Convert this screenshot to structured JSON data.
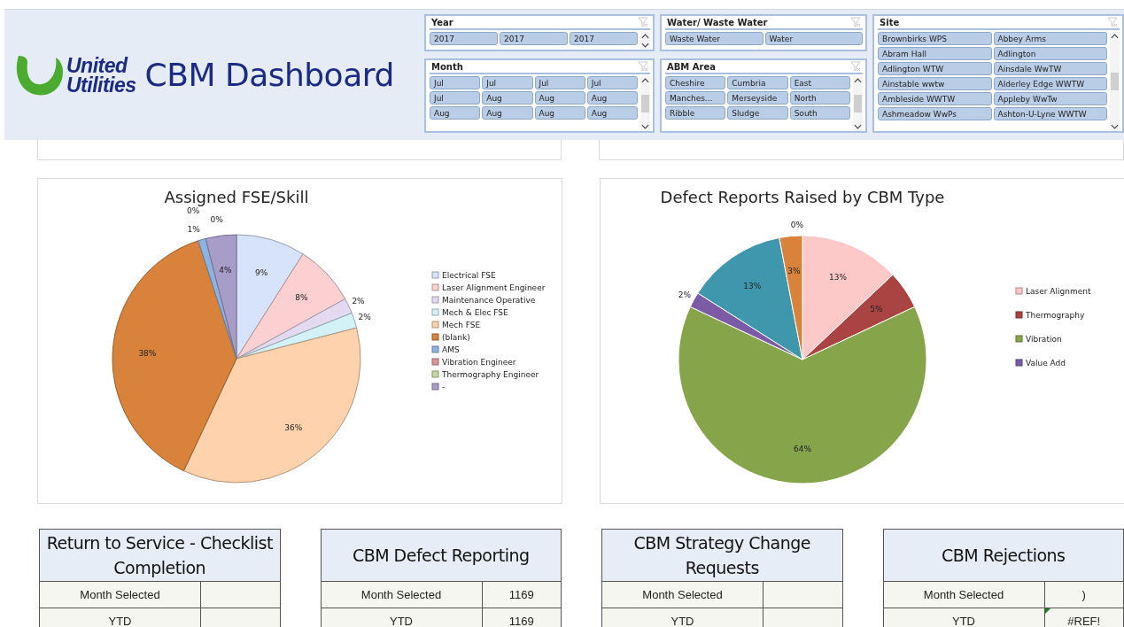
{
  "header": {
    "logo_lines": [
      "United",
      "Utilities"
    ],
    "title": "CBM Dashboard"
  },
  "slicers": [
    {
      "title": "Year",
      "scroll": true,
      "items": [
        {
          "label": "2017",
          "selected": true
        },
        {
          "label": "2017",
          "selected": true
        },
        {
          "label": "2017",
          "selected": true
        }
      ]
    },
    {
      "title": "Month",
      "scroll": true,
      "items": [
        {
          "label": "Jul",
          "selected": true
        },
        {
          "label": "Jul",
          "selected": true
        },
        {
          "label": "Jul",
          "selected": true
        },
        {
          "label": "Jul",
          "selected": true
        },
        {
          "label": "Jul",
          "selected": true
        },
        {
          "label": "Aug",
          "selected": true
        },
        {
          "label": "Aug",
          "selected": true
        },
        {
          "label": "Aug",
          "selected": true
        },
        {
          "label": "Aug",
          "selected": true
        },
        {
          "label": "Aug",
          "selected": true
        },
        {
          "label": "Aug",
          "selected": true
        },
        {
          "label": "Aug",
          "selected": true
        }
      ]
    },
    {
      "title": "Water/ Waste Water",
      "items": [
        {
          "label": "Waste Water",
          "selected": true
        },
        {
          "label": "Water",
          "selected": true
        }
      ]
    },
    {
      "title": "ABM Area",
      "scroll": true,
      "items": [
        {
          "label": "Cheshire",
          "selected": true
        },
        {
          "label": "Cumbria",
          "selected": true
        },
        {
          "label": "East",
          "selected": true
        },
        {
          "label": "Manches...",
          "selected": true
        },
        {
          "label": "Merseyside",
          "selected": true
        },
        {
          "label": "North",
          "selected": true
        },
        {
          "label": "Ribble",
          "selected": true
        },
        {
          "label": "Sludge",
          "selected": true
        },
        {
          "label": "South",
          "selected": true
        }
      ]
    },
    {
      "title": "Site",
      "scroll": true,
      "items": [
        {
          "label": "Brownbirks WPS",
          "selected": true
        },
        {
          "label": "Abbey Arms",
          "selected": true
        },
        {
          "label": "Abram Hall",
          "selected": true
        },
        {
          "label": "Adlington",
          "selected": true
        },
        {
          "label": "Adlington WTW",
          "selected": true
        },
        {
          "label": "Ainsdale WwTW",
          "selected": true
        },
        {
          "label": "Ainstable wwtw",
          "selected": true
        },
        {
          "label": "Alderley Edge WWTW",
          "selected": true
        },
        {
          "label": "Ambleside WWTW",
          "selected": true
        },
        {
          "label": "Appleby WwTw",
          "selected": true
        },
        {
          "label": "Ashmeadow WwPs",
          "selected": true
        },
        {
          "label": "Ashton-U-Lyne WWTW",
          "selected": true
        }
      ]
    }
  ],
  "panels": [
    {
      "chart_data": {
        "type": "pie",
        "title": "Assigned FSE/Skill",
        "categories": [
          "Electrical FSE",
          "Laser Alignment Engineer",
          "Maintenance Operative",
          "Mech & Elec FSE",
          "Mech FSE",
          "(blank)",
          "AMS",
          "Vibration Engineer",
          "Thermography Engineer",
          "-"
        ],
        "values": [
          9,
          8,
          2,
          2,
          36,
          38,
          1,
          0,
          0,
          4
        ],
        "value_labels": [
          "9%",
          "8%",
          "2%",
          "2%",
          "36%",
          "38%",
          "1%",
          "0%",
          "0%",
          "4%"
        ],
        "colors": [
          "#d6e3fb",
          "#fccfd0",
          "#e3daf1",
          "#d2f2f8",
          "#fdd2ad",
          "#d9823b",
          "#8db3e2",
          "#d99694",
          "#c3d69b",
          "#a89cc8"
        ],
        "legend": "right"
      }
    },
    {
      "chart_data": {
        "type": "pie",
        "title": "Defect Reports Raised by CBM Type",
        "categories": [
          "Laser Alignment",
          "Thermography",
          "Vibration",
          "Value Add",
          null,
          null,
          null
        ],
        "values": [
          13,
          5,
          64,
          2,
          13,
          3,
          0
        ],
        "value_labels": [
          "13%",
          "5%",
          "64%",
          "2%",
          "13%",
          "3%",
          "0%"
        ],
        "colors": [
          "#fcc8c8",
          "#a94442",
          "#86a44a",
          "#7b5aa6",
          "#3f97ae",
          "#d9823b",
          "#c0504d"
        ],
        "legend": "right"
      }
    }
  ],
  "tables": [
    {
      "title": "Return to Service - Checklist Completion",
      "rows": [
        {
          "label": "Month Selected",
          "error": false
        },
        {
          "label": "YTD",
          "error": false
        }
      ]
    },
    {
      "title": "CBM Defect Reporting",
      "rows": [
        {
          "label": "Month Selected",
          "value": "1169",
          "error": false
        },
        {
          "label": "YTD",
          "value": "1169",
          "error": false
        }
      ]
    },
    {
      "title": "CBM Strategy Change Requests",
      "rows": [
        {
          "label": "Month Selected",
          "error": false
        },
        {
          "label": "YTD",
          "error": false
        }
      ]
    },
    {
      "title": "CBM Rejections",
      "rows": [
        {
          "label": "Month Selected",
          "value": ")",
          "error": false
        },
        {
          "label": "YTD",
          "value": "#REF!",
          "error": true
        }
      ]
    }
  ]
}
